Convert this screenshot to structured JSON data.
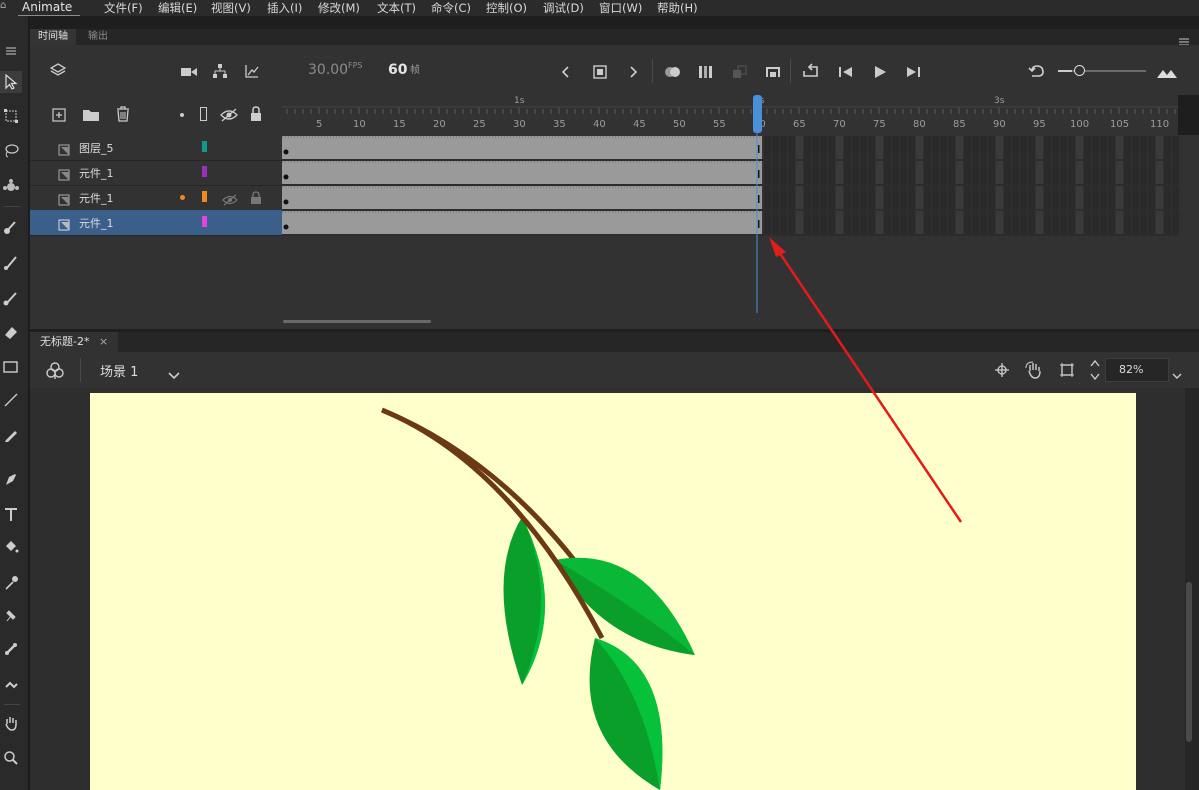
{
  "menubar": {
    "brand": "Animate",
    "items": [
      "文件(F)",
      "编辑(E)",
      "视图(V)",
      "插入(I)",
      "修改(M)",
      "文本(T)",
      "命令(C)",
      "控制(O)",
      "调试(D)",
      "窗口(W)",
      "帮助(H)"
    ]
  },
  "timeline": {
    "tabs": [
      "时间轴",
      "输出"
    ],
    "fps_value": "30.00",
    "fps_unit": "FPS",
    "frame_value": "60",
    "frame_unit": "帧",
    "second_labels": [
      "1s",
      "2s",
      "3s"
    ],
    "frame_labels": [
      "5",
      "10",
      "15",
      "20",
      "25",
      "30",
      "35",
      "40",
      "45",
      "50",
      "55",
      "60",
      "65",
      "70",
      "75",
      "80",
      "85",
      "90",
      "95",
      "100",
      "105",
      "110"
    ],
    "playhead_frame": 60,
    "layers": [
      {
        "name": "图层_5",
        "color": "#0f9a8c",
        "selected": false,
        "icons": false
      },
      {
        "name": "元件_1",
        "color": "#9a2fb8",
        "selected": false,
        "icons": false
      },
      {
        "name": "元件_1",
        "color": "#f08a1e",
        "selected": false,
        "icons": true
      },
      {
        "name": "元件_1",
        "color": "#e542e0",
        "selected": true,
        "icons": false
      }
    ]
  },
  "document": {
    "tab_title": "无标题-2*",
    "scene": "场景 1",
    "zoom": "82%"
  },
  "colors": {
    "canvas": "#ffffcc",
    "selection": "#3a5f8a",
    "playhead": "#4a8fd8",
    "annotation_arrow": "#e21b1b"
  }
}
